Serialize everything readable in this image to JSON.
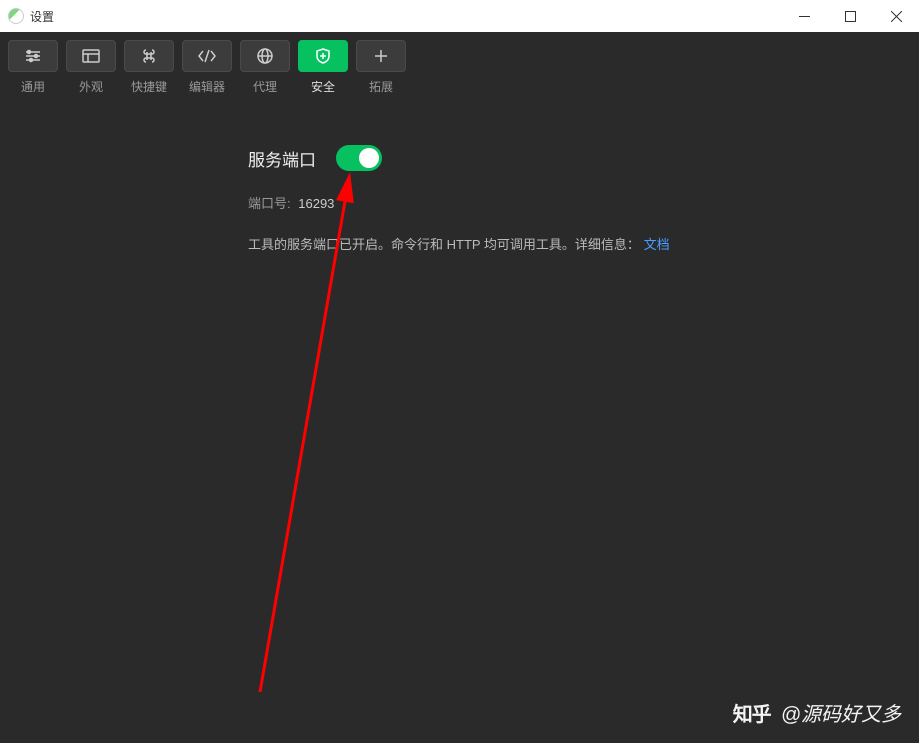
{
  "window": {
    "title": "设置"
  },
  "tabs": [
    {
      "label": "通用",
      "icon": "settings-sliders-icon"
    },
    {
      "label": "外观",
      "icon": "layout-icon"
    },
    {
      "label": "快捷键",
      "icon": "command-icon"
    },
    {
      "label": "编辑器",
      "icon": "code-icon"
    },
    {
      "label": "代理",
      "icon": "globe-icon"
    },
    {
      "label": "安全",
      "icon": "shield-icon",
      "active": true
    },
    {
      "label": "拓展",
      "icon": "plus-icon"
    }
  ],
  "security": {
    "service_port_label": "服务端口",
    "toggle_on": true,
    "port_label": "端口号:",
    "port_value": "16293",
    "description_prefix": "工具的服务端口已开启。命令行和 HTTP 均可调用工具。详细信息：",
    "link_text": "文档"
  },
  "watermark": {
    "brand": "知乎",
    "author": "@源码好又多"
  }
}
